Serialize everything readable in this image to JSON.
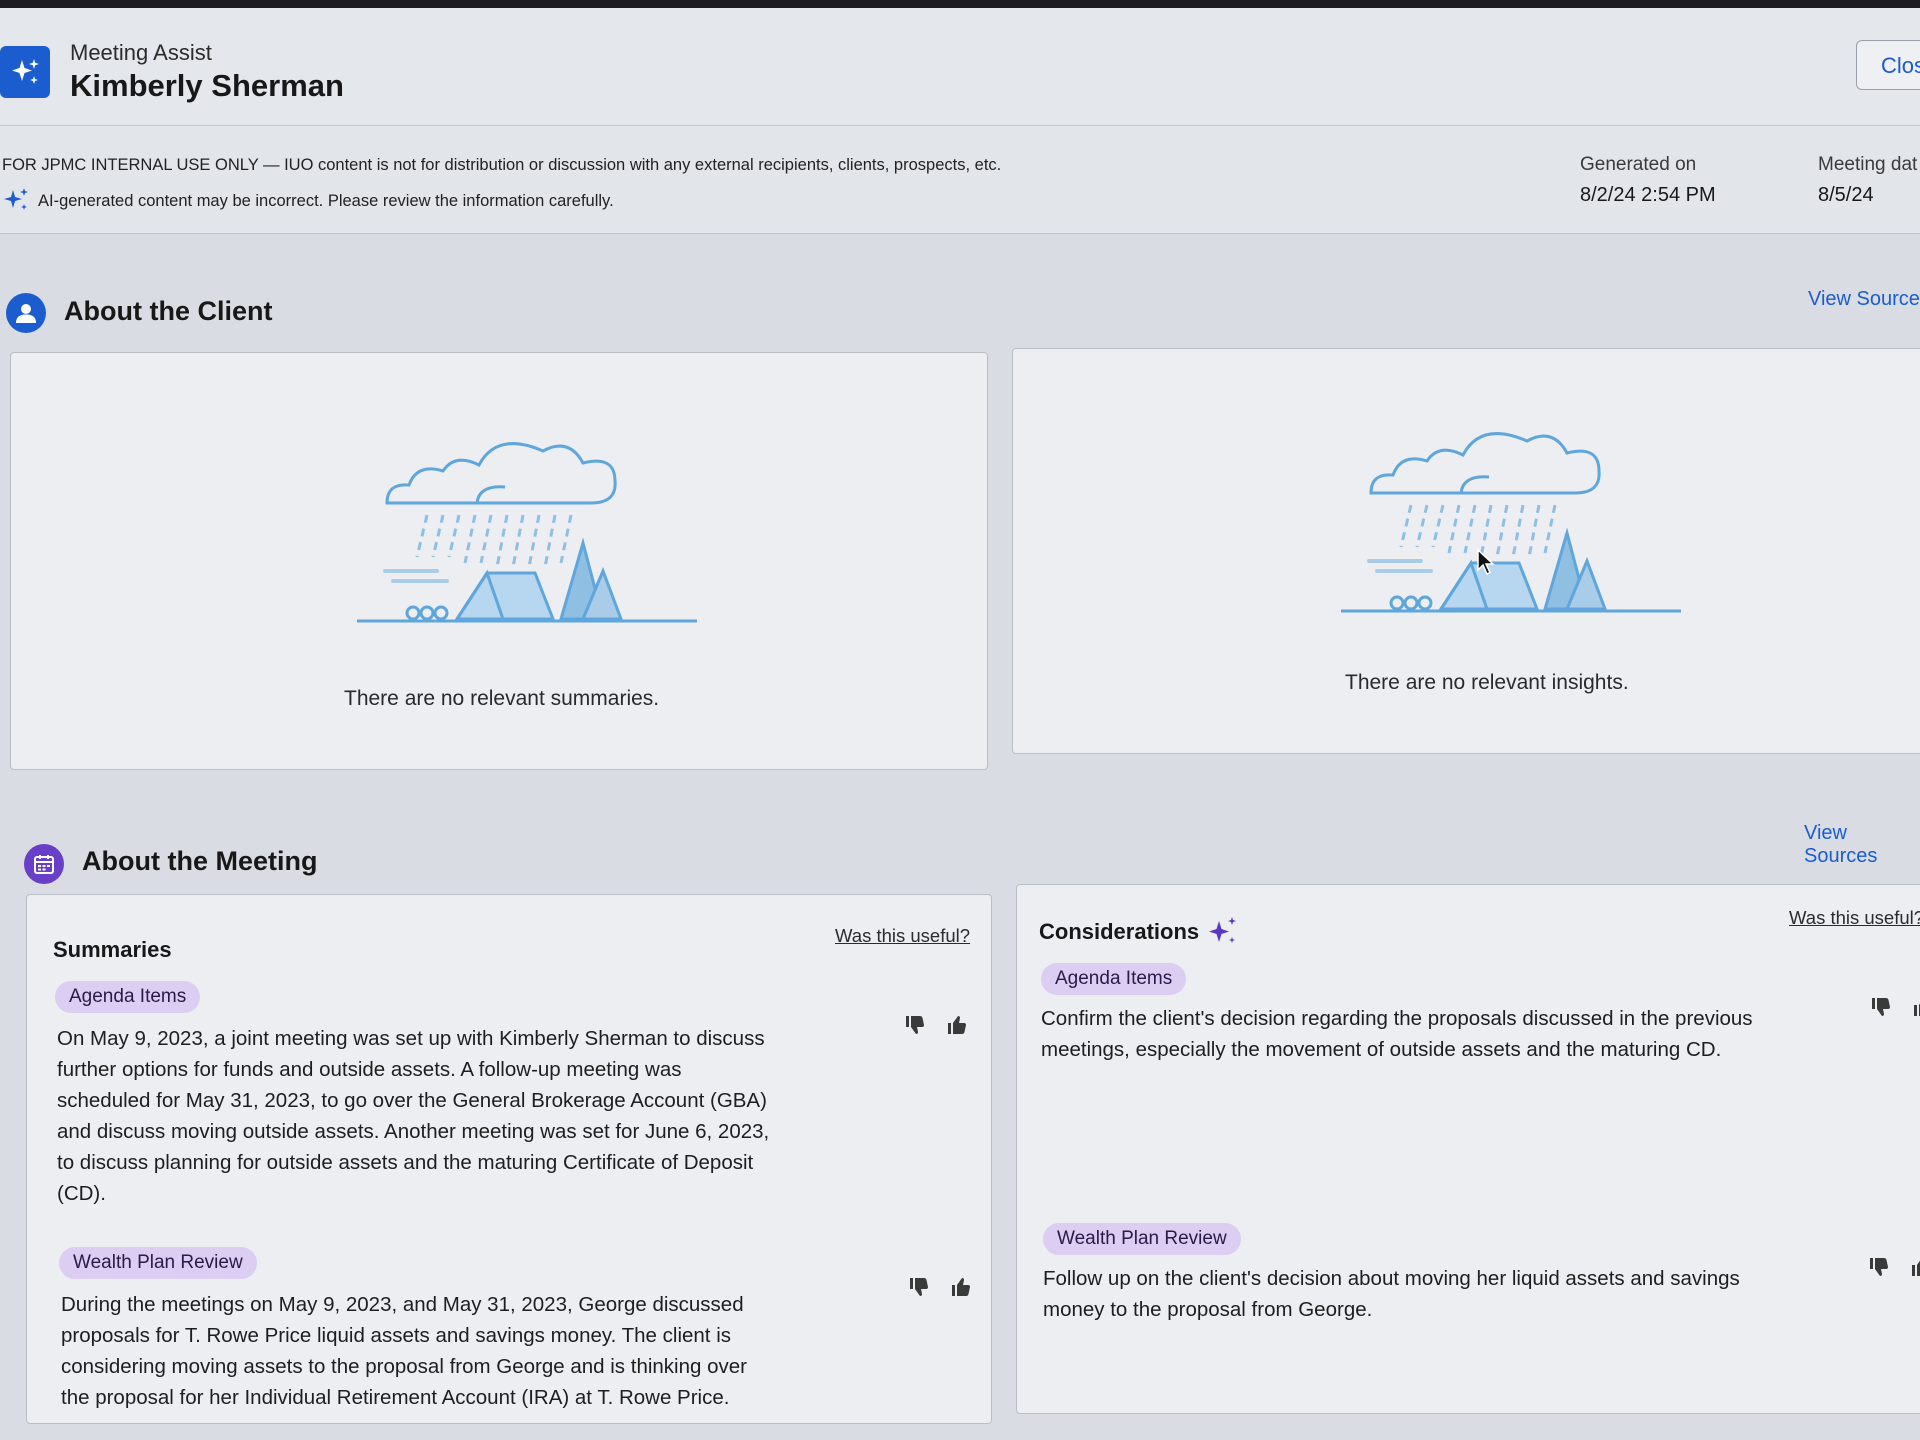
{
  "header": {
    "app_name": "Meeting Assist",
    "client_name": "Kimberly Sherman",
    "close_label": "Clos"
  },
  "notice": {
    "internal_use": "FOR JPMC INTERNAL USE ONLY — IUO content is not for distribution or discussion with any external recipients, clients, prospects, etc.",
    "ai_disclaimer": "AI-generated content may be incorrect. Please review the information carefully.",
    "generated_label": "Generated on",
    "generated_value": "8/2/24 2:54 PM",
    "meeting_label": "Meeting dat",
    "meeting_value": "8/5/24"
  },
  "about_client": {
    "title": "About the Client",
    "view_sources": "View Source",
    "summaries_empty": "There are no relevant summaries.",
    "insights_empty": "There are no relevant insights."
  },
  "about_meeting": {
    "title": "About the Meeting",
    "view_sources": "View Sources",
    "summaries": {
      "title": "Summaries",
      "was_useful": "Was this useful?",
      "items": [
        {
          "tag": "Agenda Items",
          "lines": [
            "On May 9, 2023, a joint meeting was set up with Kimberly Sherman to discuss",
            "further options for funds and outside assets. A follow-up meeting was",
            "scheduled for May 31, 2023, to go over the General Brokerage Account (GBA)",
            "and discuss moving outside assets. Another meeting was set for June 6, 2023,",
            "to discuss planning for outside assets and the maturing Certificate of Deposit",
            "(CD)."
          ]
        },
        {
          "tag": "Wealth Plan Review",
          "lines": [
            "During the meetings on May 9, 2023, and May 31, 2023, George discussed",
            "proposals for T. Rowe Price liquid assets and savings money. The client is",
            "considering moving assets to the proposal from George and is thinking over",
            "the proposal for her Individual Retirement Account (IRA) at T. Rowe Price."
          ]
        }
      ]
    },
    "considerations": {
      "title": "Considerations",
      "was_useful": "Was this useful?",
      "items": [
        {
          "tag": "Agenda Items",
          "lines": [
            "Confirm the client's decision regarding the proposals discussed in the previous",
            "meetings, especially the movement of outside assets and the maturing CD."
          ]
        },
        {
          "tag": "Wealth Plan Review",
          "lines": [
            "Follow up on the client's decision about moving her liquid assets and savings",
            "money to the proposal from George."
          ]
        }
      ]
    }
  },
  "colors": {
    "brand_blue": "#1b5ccf",
    "ai_purple": "#5b35c4",
    "tag_bg": "#dccdf2",
    "illustration_blue": "#5fa6dc"
  },
  "icons": {
    "app": "sparkle-icon",
    "client_section": "person-icon",
    "meeting_section": "calendar-icon",
    "feedback_negative": "thumbs-down-icon",
    "feedback_positive": "thumbs-up-icon"
  }
}
